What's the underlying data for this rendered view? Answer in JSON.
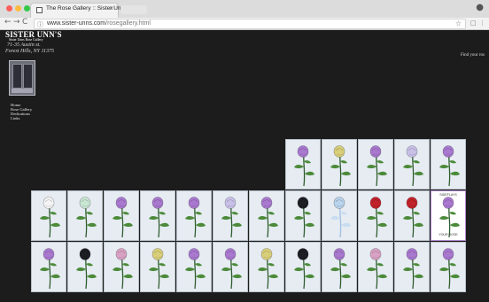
{
  "browser": {
    "tab_title": "The Rose Gallery :: Sister Unn",
    "tab_close": "×",
    "url_domain": "www.sister-unns.com",
    "url_path": "/rosegallery.html",
    "nav": {
      "back": "←",
      "forward": "→",
      "reload": "C",
      "home": "⌂"
    },
    "icons": [
      "back-icon",
      "forward-icon",
      "reload-icon",
      "home-icon",
      "star-icon",
      "extension-icon",
      "menu-icon"
    ],
    "window_buttons": {
      "close": "#fc605c",
      "minimize": "#fdbc40",
      "maximize": "#34c84a"
    }
  },
  "site": {
    "title": "SISTER UNN'S",
    "subtitle": "Sister Unns Rose Gallery",
    "address_line1": "71-35 Austin st.",
    "address_line2": "Forest Hills, NY 11375",
    "menu": [
      "Home",
      "Rose Gallery",
      "Dedications",
      "Links"
    ],
    "find_text": "Find your ros"
  },
  "gallery": {
    "selected_top": "SIDEFLAYS",
    "selected_bottom": "YOUR ROSE",
    "rows": [
      [
        "lavender",
        "yellow",
        "lavender",
        "lightlavender",
        "lavender"
      ],
      [
        "white",
        "mint",
        "lavender",
        "lavender",
        "lavender",
        "lightlavender",
        "lavender",
        "black",
        "sketch",
        "red",
        "red",
        "selected"
      ],
      [
        "lavender",
        "black",
        "pink",
        "yellow",
        "lavender",
        "lavender",
        "yellow",
        "black",
        "lavender",
        "pink",
        "lavender",
        "lavender"
      ]
    ],
    "colors": {
      "lavender": "#a978cf",
      "lightlavender": "#c9c0e8",
      "yellow": "#d9cf7a",
      "white": "#f4f4f4",
      "mint": "#c9e6d3",
      "black": "#1d1d24",
      "red": "#c2222a",
      "pink": "#d9a2c4",
      "sketch": "#b9d4ec"
    }
  }
}
